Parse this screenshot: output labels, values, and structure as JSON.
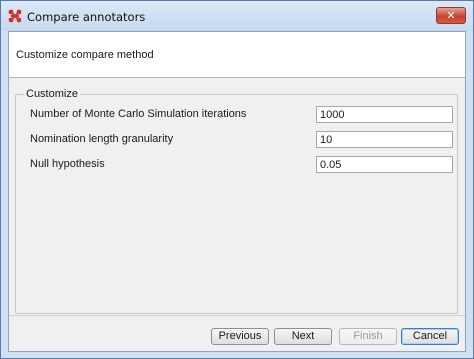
{
  "window": {
    "title": "Compare annotators",
    "close_symbol": "✕"
  },
  "header": {
    "text": "Customize compare method"
  },
  "group": {
    "legend": "Customize",
    "fields": [
      {
        "label": "Number of Monte Carlo Simulation iterations",
        "value": "1000"
      },
      {
        "label": "Nomination length granularity",
        "value": "10"
      },
      {
        "label": "Null hypothesis",
        "value": "0.05"
      }
    ]
  },
  "buttons": {
    "previous": "Previous",
    "next": "Next",
    "finish": "Finish",
    "cancel": "Cancel"
  },
  "icons": {
    "app": "app-logo-icon",
    "close": "close-icon"
  },
  "colors": {
    "title_bar": "#c5d9ee",
    "close_button": "#c7432d",
    "default_button_border": "#3a7bd5",
    "app_icon": "#d0312d"
  }
}
